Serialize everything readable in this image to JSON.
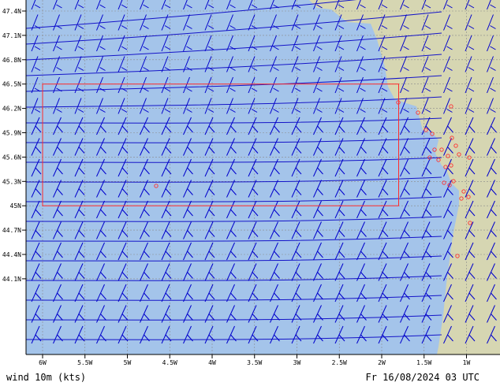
{
  "map": {
    "latitudes": [
      47.4,
      47.1,
      46.8,
      46.5,
      46.2,
      45.9,
      45.6,
      45.3,
      45.0,
      44.7,
      44.4,
      44.1
    ],
    "lat_labels": [
      "47.4N",
      "47.1N",
      "46.8N",
      "46.5N",
      "46.2N",
      "45.9N",
      "45.6N",
      "45.3N",
      "45N",
      "44.7N",
      "44.4N",
      "44.1N"
    ],
    "longitudes": [
      -6.0,
      -5.5,
      -5.0,
      -4.5,
      -4.0,
      -3.5,
      -3.0,
      -2.5,
      -2.0,
      -1.5,
      -1.0
    ],
    "lon_labels": [
      "6W",
      "5.5W",
      "5W",
      "4.5W",
      "4W",
      "3.5W",
      "3W",
      "2.5W",
      "2W",
      "1.5W",
      "1W"
    ],
    "colors": {
      "sea": "#a4c4ea",
      "land": "#d6d6b2",
      "streamline": "#1414c8",
      "barb": "#0000cc",
      "box": "#ff2a2a",
      "station": "#ff3030",
      "grid": "#8a8a8a"
    },
    "region_box": {
      "lon_min": -6.0,
      "lon_max": -1.8,
      "lat_min": 45.0,
      "lat_max": 46.5
    }
  },
  "footer": {
    "variable": "wind 10m (kts)",
    "valid_time": "Fr 16/08/2024 03 UTC"
  }
}
